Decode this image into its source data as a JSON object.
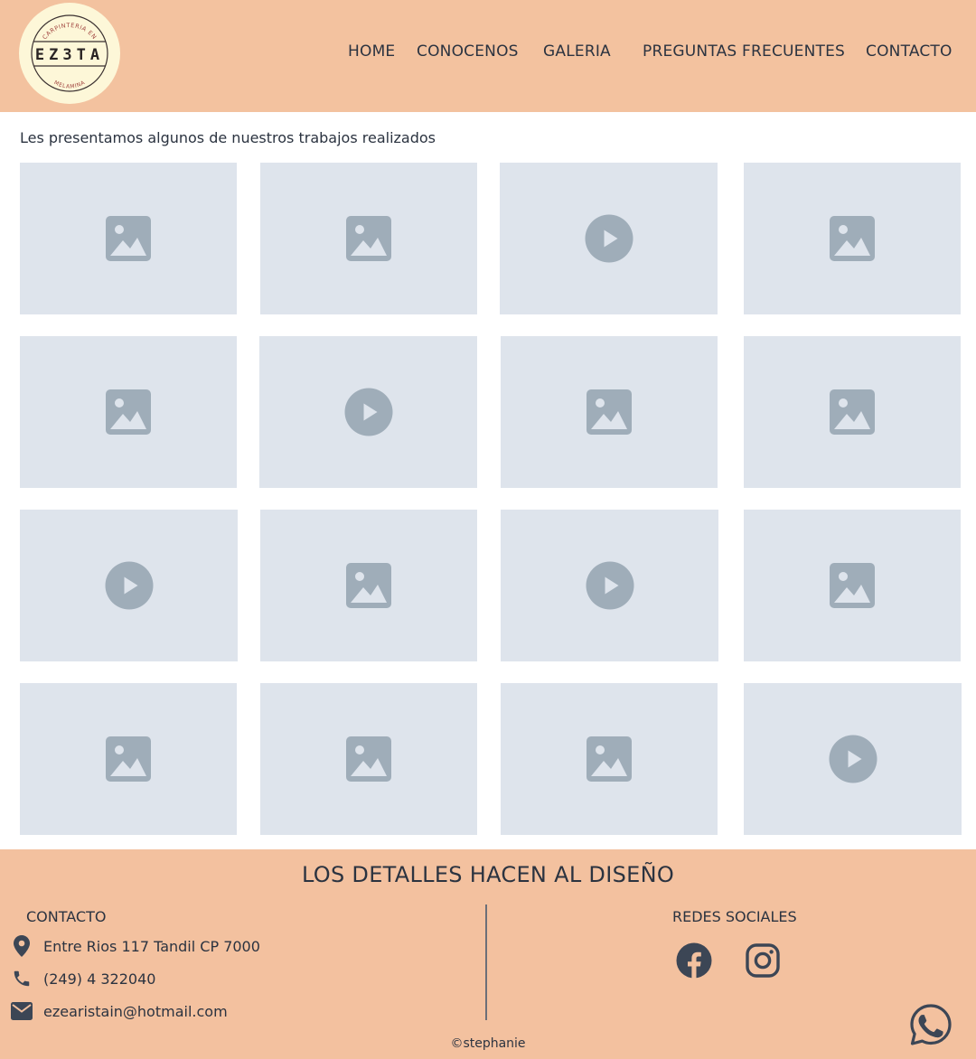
{
  "header": {
    "logo": {
      "top_text": "CARPINTERIA EN",
      "name": "EZ3TA",
      "bottom_text": "MELAMINA"
    },
    "nav": [
      "HOME",
      "CONOCENOS",
      "GALERIA",
      "PREGUNTAS FRECUENTES",
      "CONTACTO"
    ]
  },
  "gallery": {
    "intro": "Les presentamos algunos de nuestros trabajos realizados",
    "tiles": [
      {
        "kind": "image-placeholder-icon"
      },
      {
        "kind": "image-placeholder-icon"
      },
      {
        "kind": "video-placeholder-icon"
      },
      {
        "kind": "image-placeholder-icon"
      },
      {
        "kind": "image-placeholder-icon"
      },
      {
        "kind": "video-placeholder-icon"
      },
      {
        "kind": "image-placeholder-icon"
      },
      {
        "kind": "image-placeholder-icon"
      },
      {
        "kind": "video-placeholder-icon"
      },
      {
        "kind": "image-placeholder-icon"
      },
      {
        "kind": "video-placeholder-icon"
      },
      {
        "kind": "image-placeholder-icon"
      },
      {
        "kind": "image-placeholder-icon"
      },
      {
        "kind": "image-placeholder-icon"
      },
      {
        "kind": "image-placeholder-icon"
      },
      {
        "kind": "video-placeholder-icon"
      }
    ]
  },
  "footer": {
    "tagline": "LOS DETALLES HACEN AL DISEÑO",
    "contact": {
      "heading": "CONTACTO",
      "address": "Entre Rios 117 Tandil CP 7000",
      "phone": "(249) 4 322040",
      "email": "ezearistain@hotmail.com"
    },
    "social": {
      "heading": "REDES SOCIALES",
      "icons": [
        "facebook-icon",
        "instagram-icon"
      ]
    },
    "copyright": "©stephanie",
    "floating_icon": "whatsapp-icon"
  },
  "colors": {
    "header_bg": "#f3c29f",
    "footer_bg": "#f3c19f",
    "tile_bg": "#dee4ec",
    "placeholder_icon": "#9fadb9",
    "text": "#2b3340"
  }
}
